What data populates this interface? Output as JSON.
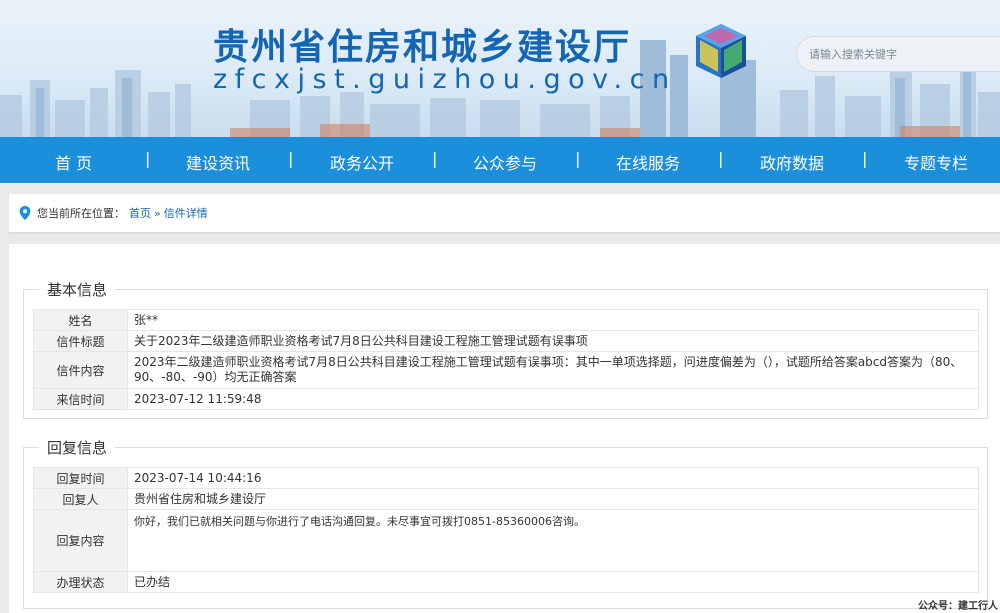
{
  "header": {
    "title": "贵州省住房和城乡建设厅",
    "domain": "zfcxjst.guizhou.gov.cn",
    "search_placeholder": "请输入搜索关键字"
  },
  "nav": {
    "items": [
      "首 页",
      "建设资讯",
      "政务公开",
      "公众参与",
      "在线服务",
      "政府数据",
      "专题专栏"
    ],
    "separator": "|"
  },
  "breadcrumb": {
    "label": "您当前所在位置：",
    "home": "首页",
    "separator": "»",
    "current": "信件详情"
  },
  "basic_info": {
    "heading": "基本信息",
    "rows": [
      {
        "label": "姓名",
        "value": "张**"
      },
      {
        "label": "信件标题",
        "value": "关于2023年二级建造师职业资格考试7月8日公共科目建设工程施工管理试题有误事项"
      },
      {
        "label": "信件内容",
        "value": "2023年二级建造师职业资格考试7月8日公共科目建设工程施工管理试题有误事项：其中一单项选择题，问进度偏差为（），试题所给答案abcd答案为（80、90、-80、-90）均无正确答案"
      },
      {
        "label": "来信时间",
        "value": "2023-07-12 11:59:48"
      }
    ]
  },
  "reply_info": {
    "heading": "回复信息",
    "rows": [
      {
        "label": "回复时间",
        "value": "2023-07-14 10:44:16"
      },
      {
        "label": "回复人",
        "value": "贵州省住房和城乡建设厅"
      },
      {
        "label": "回复内容",
        "value": "你好，我们已就相关问题与你进行了电话沟通回复。未尽事宜可拨打0851-85360006咨询。"
      },
      {
        "label": "办理状态",
        "value": "已办结"
      }
    ]
  },
  "watermark": "公众号：建工行人",
  "colors": {
    "nav_bg": "#1b8fdc",
    "title_blue": "#1565b5"
  }
}
